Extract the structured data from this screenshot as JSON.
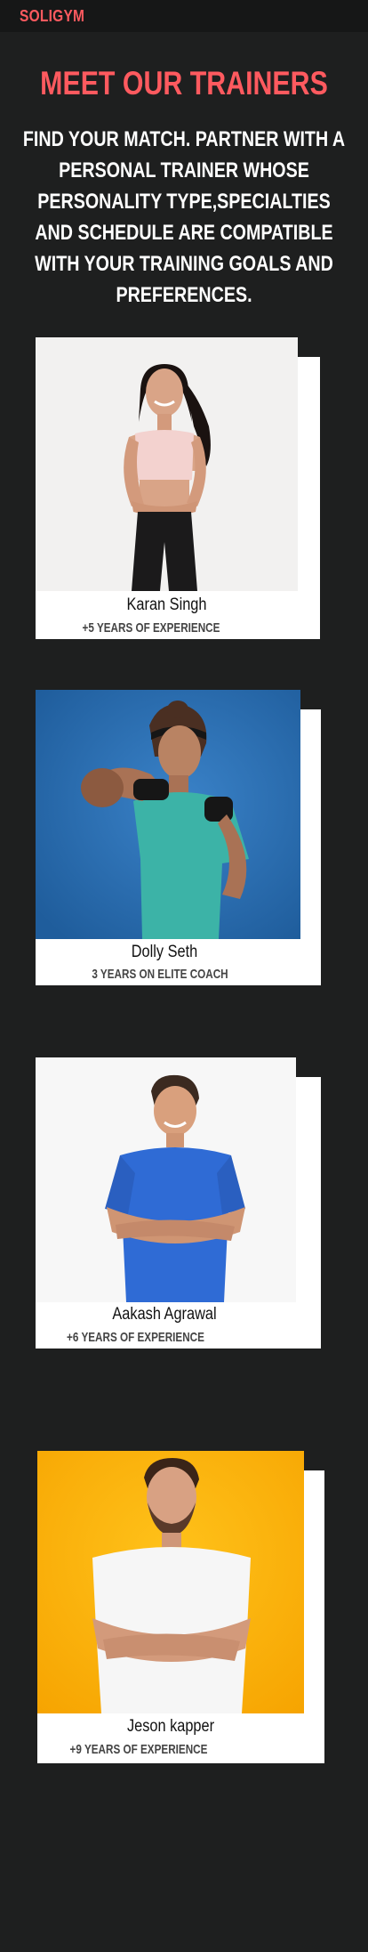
{
  "brand": "SOLIGYM",
  "hero": {
    "title": "MEET OUR TRAINERS",
    "subtitle": "FIND YOUR MATCH. PARTNER WITH A PERSONAL TRAINER WHOSE PERSONALITY TYPE,SPECIALTIES AND SCHEDULE ARE COMPATIBLE WITH YOUR TRAINING GOALS AND PREFERENCES."
  },
  "trainers": [
    {
      "name": "Karan Singh",
      "experience": "+5 YEARS OF EXPERIENCE"
    },
    {
      "name": "Dolly Seth",
      "experience": "3 YEARS ON ELITE COACH"
    },
    {
      "name": "Aakash Agrawal",
      "experience": "+6 YEARS OF EXPERIENCE"
    },
    {
      "name": "Jeson kapper",
      "experience": "+9 YEARS OF EXPERIENCE"
    }
  ],
  "colors": {
    "background": "#1e1f1f",
    "topbar": "#161717",
    "accent": "#ff5a5f",
    "photo_1_bg": "#f2f1f0",
    "photo_2_bg": "#2b6fb4",
    "photo_3_bg": "#f7f7f7",
    "photo_4_bg": "#ffb300"
  }
}
